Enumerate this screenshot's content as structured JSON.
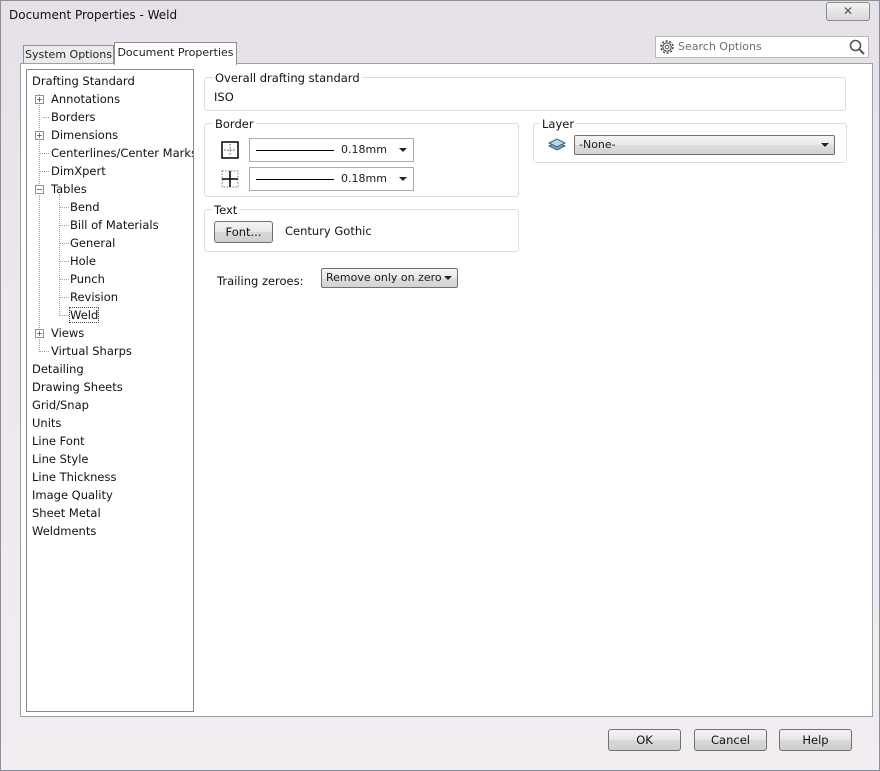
{
  "window": {
    "title": "Document Properties - Weld",
    "close_glyph": "✕"
  },
  "tabs": [
    {
      "label": "System Options",
      "active": false
    },
    {
      "label": "Document Properties",
      "active": true
    }
  ],
  "search": {
    "placeholder": "Search Options",
    "icons": [
      "gear-icon",
      "magnifier-icon"
    ]
  },
  "tree": {
    "items": [
      {
        "label": "Drafting Standard",
        "level": 0
      },
      {
        "label": "Annotations",
        "level": 1,
        "expander": "+"
      },
      {
        "label": "Borders",
        "level": 1
      },
      {
        "label": "Dimensions",
        "level": 1,
        "expander": "+"
      },
      {
        "label": "Centerlines/Center Marks",
        "level": 1
      },
      {
        "label": "DimXpert",
        "level": 1
      },
      {
        "label": "Tables",
        "level": 1,
        "expander": "−"
      },
      {
        "label": "Bend",
        "level": 2
      },
      {
        "label": "Bill of Materials",
        "level": 2
      },
      {
        "label": "General",
        "level": 2
      },
      {
        "label": "Hole",
        "level": 2
      },
      {
        "label": "Punch",
        "level": 2
      },
      {
        "label": "Revision",
        "level": 2
      },
      {
        "label": "Weld",
        "level": 2,
        "selected": true
      },
      {
        "label": "Views",
        "level": 1,
        "expander": "+"
      },
      {
        "label": "Virtual Sharps",
        "level": 1
      },
      {
        "label": "Detailing",
        "level": 0
      },
      {
        "label": "Drawing Sheets",
        "level": 0
      },
      {
        "label": "Grid/Snap",
        "level": 0
      },
      {
        "label": "Units",
        "level": 0
      },
      {
        "label": "Line Font",
        "level": 0
      },
      {
        "label": "Line Style",
        "level": 0
      },
      {
        "label": "Line Thickness",
        "level": 0
      },
      {
        "label": "Image Quality",
        "level": 0
      },
      {
        "label": "Sheet Metal",
        "level": 0
      },
      {
        "label": "Weldments",
        "level": 0
      }
    ]
  },
  "overall": {
    "title": "Overall drafting standard",
    "value": "ISO"
  },
  "border": {
    "title": "Border",
    "outer": {
      "thickness": "0.18mm",
      "icon": "outer-border-icon"
    },
    "inner": {
      "thickness": "0.18mm",
      "icon": "inner-border-icon"
    }
  },
  "layer": {
    "title": "Layer",
    "value": "-None-",
    "icon": "layers-icon"
  },
  "text": {
    "title": "Text",
    "font_button": "Font...",
    "font_name": "Century Gothic"
  },
  "trailing": {
    "label": "Trailing zeroes:",
    "value": "Remove only on zero"
  },
  "footer": {
    "ok": "OK",
    "cancel": "Cancel",
    "help": "Help"
  }
}
